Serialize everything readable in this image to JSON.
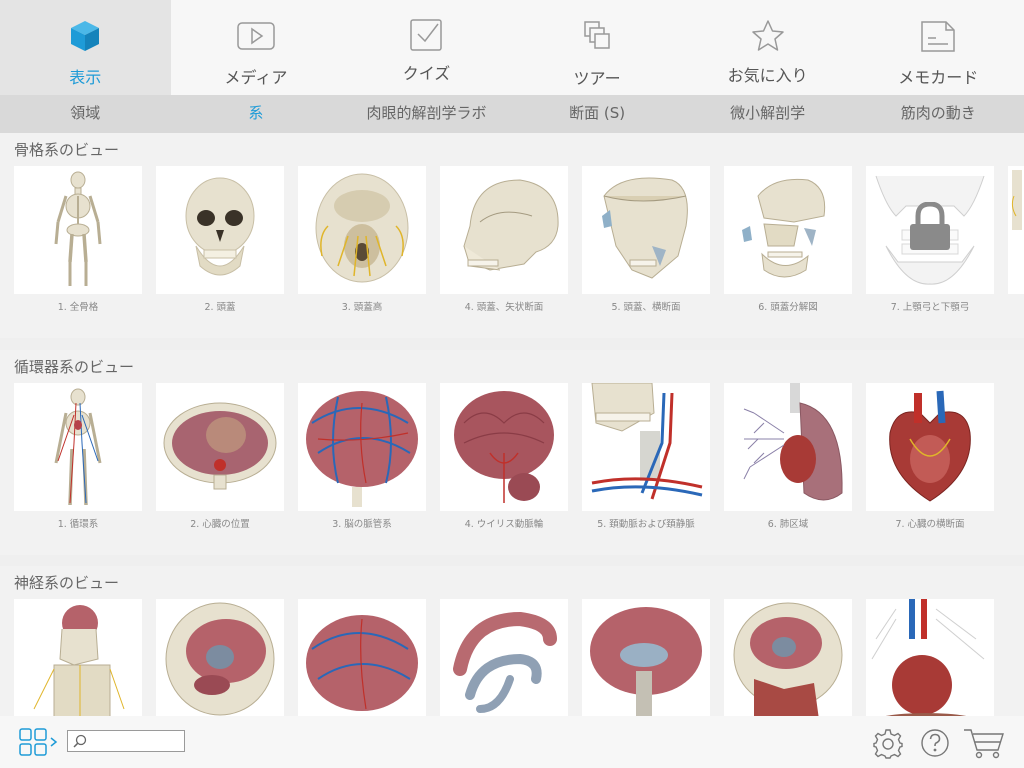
{
  "top_tabs": [
    {
      "label": "表示",
      "icon": "cube-icon",
      "active": true
    },
    {
      "label": "メディア",
      "icon": "play-icon",
      "active": false
    },
    {
      "label": "クイズ",
      "icon": "checkbox-icon",
      "active": false
    },
    {
      "label": "ツアー",
      "icon": "copy-pages-icon",
      "active": false
    },
    {
      "label": "お気に入り",
      "icon": "star-icon",
      "active": false
    },
    {
      "label": "メモカード",
      "icon": "note-card-icon",
      "active": false
    }
  ],
  "sub_tabs": [
    {
      "label": "領域",
      "active": false
    },
    {
      "label": "系",
      "active": true
    },
    {
      "label": "肉眼的解剖学ラボ",
      "active": false
    },
    {
      "label": "断面 (S)",
      "active": false
    },
    {
      "label": "微小解剖学",
      "active": false
    },
    {
      "label": "筋肉の動き",
      "active": false
    }
  ],
  "sections": [
    {
      "title": "骨格系のビュー",
      "items": [
        {
          "caption": "1. 全骨格",
          "thumb": "full-skeleton"
        },
        {
          "caption": "2. 頭蓋",
          "thumb": "skull-front"
        },
        {
          "caption": "3. 頭蓋高",
          "thumb": "skull-base"
        },
        {
          "caption": "4. 頭蓋、矢状断面",
          "thumb": "skull-sagittal"
        },
        {
          "caption": "5. 頭蓋、横断面",
          "thumb": "skull-transverse"
        },
        {
          "caption": "6. 頭蓋分解図",
          "thumb": "skull-exploded"
        },
        {
          "caption": "7. 上顎弓と下顎弓",
          "thumb": "jaws-locked",
          "locked": true
        }
      ]
    },
    {
      "title": "循環器系のビュー",
      "items": [
        {
          "caption": "1. 循環系",
          "thumb": "circulatory-body"
        },
        {
          "caption": "2. 心臓の位置",
          "thumb": "heart-position"
        },
        {
          "caption": "3. 脳の脈管系",
          "thumb": "brain-vessels"
        },
        {
          "caption": "4. ウイリス動脈輪",
          "thumb": "circle-of-willis"
        },
        {
          "caption": "5. 頚動脈および頚静脈",
          "thumb": "neck-vessels"
        },
        {
          "caption": "6. 肺区域",
          "thumb": "lung-segments"
        },
        {
          "caption": "7. 心臓の横断面",
          "thumb": "heart-section"
        }
      ]
    },
    {
      "title": "神経系のビュー",
      "items": [
        {
          "caption": "",
          "thumb": "nervous-body"
        },
        {
          "caption": "",
          "thumb": "head-brain"
        },
        {
          "caption": "",
          "thumb": "brain-vessels-2"
        },
        {
          "caption": "",
          "thumb": "ventricles"
        },
        {
          "caption": "",
          "thumb": "brain-sagittal"
        },
        {
          "caption": "",
          "thumb": "head-section"
        },
        {
          "caption": "",
          "thumb": "heart-nerves"
        }
      ]
    }
  ],
  "bottom_bar": {
    "grid_icon": "grid-view-icon",
    "search_placeholder": "",
    "icons": [
      "settings-icon",
      "help-icon",
      "cart-icon"
    ]
  },
  "colors": {
    "accent": "#1e9bd7",
    "bone": "#e7e1cf",
    "tissue": "#b5626a",
    "vessel_blue": "#2a68b8",
    "vessel_red": "#c0302a"
  }
}
